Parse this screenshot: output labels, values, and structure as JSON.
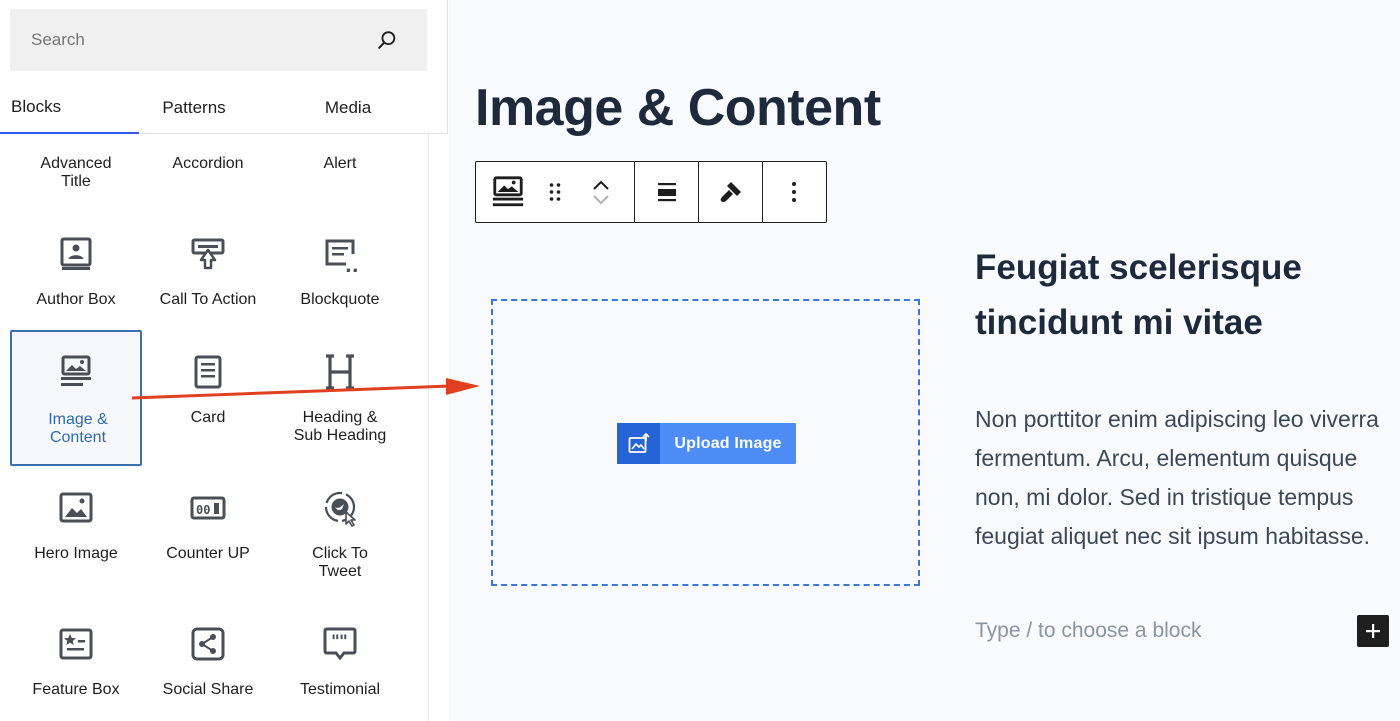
{
  "search": {
    "placeholder": "Search",
    "icon": "search-icon"
  },
  "tabs": [
    {
      "label": "Blocks",
      "active": true
    },
    {
      "label": "Patterns",
      "active": false
    },
    {
      "label": "Media",
      "active": false
    }
  ],
  "blocks": [
    {
      "label_line1": "Advanced",
      "label_line2": "Title",
      "icon": ""
    },
    {
      "label_line1": "Accordion",
      "label_line2": "",
      "icon": ""
    },
    {
      "label_line1": "Alert",
      "label_line2": "",
      "icon": ""
    },
    {
      "label_line1": "Author Box",
      "label_line2": "",
      "icon": "author-box-icon"
    },
    {
      "label_line1": "Call To Action",
      "label_line2": "",
      "icon": "call-to-action-icon"
    },
    {
      "label_line1": "Blockquote",
      "label_line2": "",
      "icon": "blockquote-icon"
    },
    {
      "label_line1": "Image &",
      "label_line2": "Content",
      "icon": "image-content-icon",
      "selected": true
    },
    {
      "label_line1": "Card",
      "label_line2": "",
      "icon": "card-icon"
    },
    {
      "label_line1": "Heading &",
      "label_line2": "Sub Heading",
      "icon": "heading-icon"
    },
    {
      "label_line1": "Hero Image",
      "label_line2": "",
      "icon": "hero-image-icon"
    },
    {
      "label_line1": "Counter UP",
      "label_line2": "",
      "icon": "counter-up-icon"
    },
    {
      "label_line1": "Click To",
      "label_line2": "Tweet",
      "icon": "click-to-tweet-icon"
    },
    {
      "label_line1": "Feature Box",
      "label_line2": "",
      "icon": "feature-box-icon"
    },
    {
      "label_line1": "Social Share",
      "label_line2": "",
      "icon": "social-share-icon"
    },
    {
      "label_line1": "Testimonial",
      "label_line2": "",
      "icon": "testimonial-icon"
    }
  ],
  "editor": {
    "page_title": "Image & Content",
    "upload_label": "Upload Image",
    "content_heading": "Feugiat scelerisque tincidunt mi vitae",
    "content_paragraph": "Non porttitor enim adipiscing leo viverra fermentum. Arcu, elementum quisque non, mi dolor. Sed in tristique tempus feugiat aliquet nec sit ipsum habitasse.",
    "block_placeholder": "Type / to choose a block",
    "add_block_icon": "plus-icon"
  },
  "colors": {
    "selected_border": "#3a6fb0",
    "tab_active": "#3858e9",
    "upload_button": "#4d8cf5",
    "upload_icon_bg": "#2563d6",
    "drop_border": "#3a78d8",
    "annotation_arrow": "#e0401f"
  }
}
